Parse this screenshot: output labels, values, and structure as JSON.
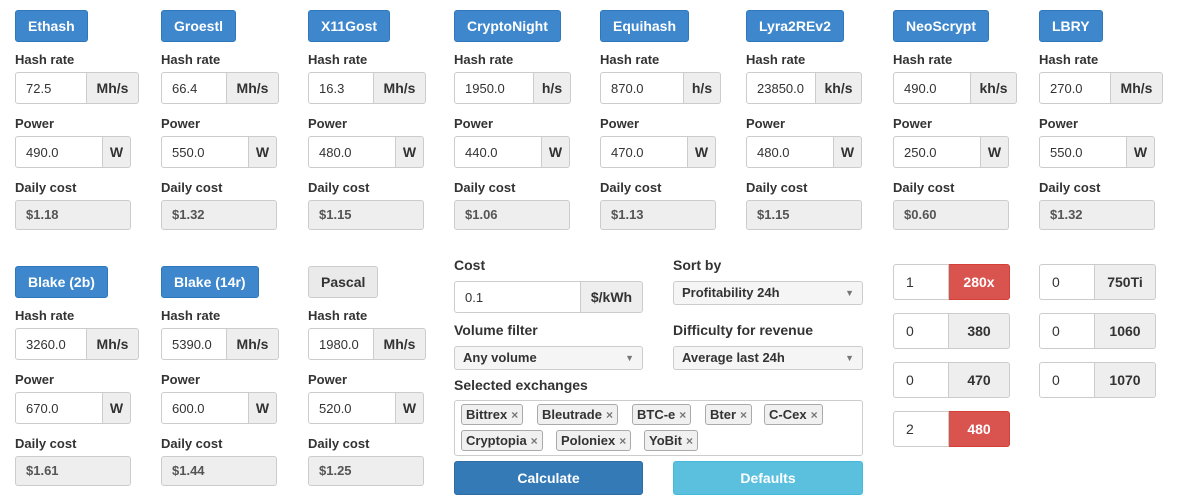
{
  "labels": {
    "hash_rate": "Hash rate",
    "power": "Power",
    "daily_cost": "Daily cost"
  },
  "algorithms": [
    {
      "name": "Ethash",
      "enabled": true,
      "hash_rate": "72.5",
      "hash_unit": "Mh/s",
      "power": "490.0",
      "power_unit": "W",
      "daily_cost": "$1.18"
    },
    {
      "name": "Groestl",
      "enabled": true,
      "hash_rate": "66.4",
      "hash_unit": "Mh/s",
      "power": "550.0",
      "power_unit": "W",
      "daily_cost": "$1.32"
    },
    {
      "name": "X11Gost",
      "enabled": true,
      "hash_rate": "16.3",
      "hash_unit": "Mh/s",
      "power": "480.0",
      "power_unit": "W",
      "daily_cost": "$1.15"
    },
    {
      "name": "CryptoNight",
      "enabled": true,
      "hash_rate": "1950.0",
      "hash_unit": "h/s",
      "power": "440.0",
      "power_unit": "W",
      "daily_cost": "$1.06"
    },
    {
      "name": "Equihash",
      "enabled": true,
      "hash_rate": "870.0",
      "hash_unit": "h/s",
      "power": "470.0",
      "power_unit": "W",
      "daily_cost": "$1.13"
    },
    {
      "name": "Lyra2REv2",
      "enabled": true,
      "hash_rate": "23850.0",
      "hash_unit": "kh/s",
      "power": "480.0",
      "power_unit": "W",
      "daily_cost": "$1.15"
    },
    {
      "name": "NeoScrypt",
      "enabled": true,
      "hash_rate": "490.0",
      "hash_unit": "kh/s",
      "power": "250.0",
      "power_unit": "W",
      "daily_cost": "$0.60"
    },
    {
      "name": "LBRY",
      "enabled": true,
      "hash_rate": "270.0",
      "hash_unit": "Mh/s",
      "power": "550.0",
      "power_unit": "W",
      "daily_cost": "$1.32"
    },
    {
      "name": "Blake (2b)",
      "enabled": true,
      "hash_rate": "3260.0",
      "hash_unit": "Mh/s",
      "power": "670.0",
      "power_unit": "W",
      "daily_cost": "$1.61"
    },
    {
      "name": "Blake (14r)",
      "enabled": true,
      "hash_rate": "5390.0",
      "hash_unit": "Mh/s",
      "power": "600.0",
      "power_unit": "W",
      "daily_cost": "$1.44"
    },
    {
      "name": "Pascal",
      "enabled": false,
      "hash_rate": "1980.0",
      "hash_unit": "Mh/s",
      "power": "520.0",
      "power_unit": "W",
      "daily_cost": "$1.25"
    }
  ],
  "settings": {
    "cost_label": "Cost",
    "cost_value": "0.1",
    "cost_unit": "$/kWh",
    "sort_label": "Sort by",
    "sort_value": "Profitability 24h",
    "volume_label": "Volume filter",
    "volume_value": "Any volume",
    "difficulty_label": "Difficulty for revenue",
    "difficulty_value": "Average last 24h",
    "exchanges_label": "Selected exchanges",
    "exchanges": [
      "Bittrex",
      "Bleutrade",
      "BTC-e",
      "Bter",
      "C-Cex",
      "Cryptopia",
      "Poloniex",
      "YoBit"
    ],
    "calculate_label": "Calculate",
    "defaults_label": "Defaults",
    "tag_remove_glyph": "×",
    "caret_glyph": "▼"
  },
  "gpus": [
    {
      "count": "1",
      "name": "280x",
      "highlighted": true
    },
    {
      "count": "0",
      "name": "380",
      "highlighted": false
    },
    {
      "count": "0",
      "name": "470",
      "highlighted": false
    },
    {
      "count": "2",
      "name": "480",
      "highlighted": true
    },
    {
      "count": "0",
      "name": "750Ti",
      "highlighted": false
    },
    {
      "count": "0",
      "name": "1060",
      "highlighted": false
    },
    {
      "count": "0",
      "name": "1070",
      "highlighted": false
    }
  ],
  "colors": {
    "primary": "#3e87cc",
    "info": "#5bc0de",
    "danger": "#d9534f",
    "calculate": "#337ab7"
  }
}
